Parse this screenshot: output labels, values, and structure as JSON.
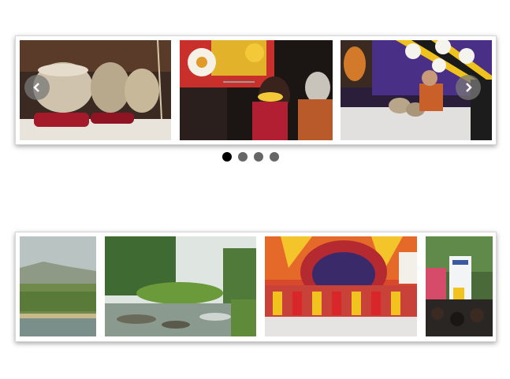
{
  "carousel_top": {
    "slides": [
      {
        "icon": "tabla-drums-photo"
      },
      {
        "icon": "singer-performance-photo"
      },
      {
        "icon": "stage-musicians-photo"
      }
    ],
    "prev_icon": "chevron-left-icon",
    "next_icon": "chevron-right-icon",
    "pagination": {
      "count": 4,
      "active_index": 0
    }
  },
  "carousel_bottom": {
    "slides": [
      {
        "icon": "hill-landscape-photo"
      },
      {
        "icon": "forest-river-photo"
      },
      {
        "icon": "dancers-stage-photo"
      },
      {
        "icon": "festival-crowd-photo"
      }
    ]
  },
  "colors": {
    "dot_active": "#000000",
    "dot_inactive": "#666666",
    "nav_button": "#808080"
  }
}
